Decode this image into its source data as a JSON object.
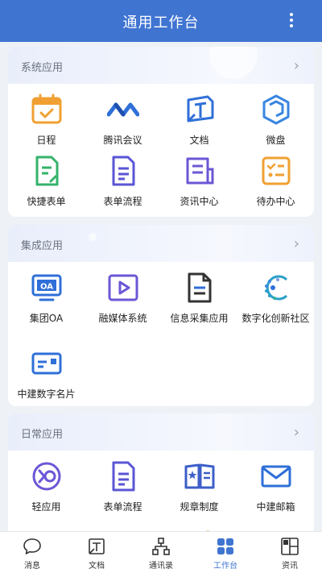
{
  "header": {
    "title": "通用工作台"
  },
  "sections": [
    {
      "title": "系统应用",
      "items": [
        "日程",
        "腾讯会议",
        "文档",
        "微盘",
        "快捷表单",
        "表单流程",
        "资讯中心",
        "待办中心"
      ]
    },
    {
      "title": "集成应用",
      "items": [
        "集团OA",
        "融媒体系统",
        "信息采集应用",
        "数字化创新社区",
        "中建数字名片"
      ]
    },
    {
      "title": "日常应用",
      "items": [
        "轻应用",
        "表单流程",
        "规章制度",
        "中建邮箱"
      ]
    }
  ],
  "tabs": [
    "消息",
    "文档",
    "通讯录",
    "工作台",
    "资讯"
  ],
  "active_tab": "工作台",
  "icon_names": [
    "calendar-icon",
    "tencent-meeting-icon",
    "document-icon",
    "micro-disk-icon",
    "quick-form-icon",
    "form-flow-icon",
    "news-center-icon",
    "todo-center-icon",
    "oa-icon",
    "media-system-icon",
    "info-collect-icon",
    "innovation-community-icon",
    "business-card-icon",
    "light-app-icon",
    "form-flow-icon",
    "rules-book-icon",
    "mail-icon"
  ],
  "colors": {
    "header": "#3f74d1",
    "accent_blue": "#2f6fd8",
    "orange": "#f0a032",
    "green": "#34b36b",
    "purple": "#6b57d6",
    "active_tab": "#3f74d1"
  }
}
